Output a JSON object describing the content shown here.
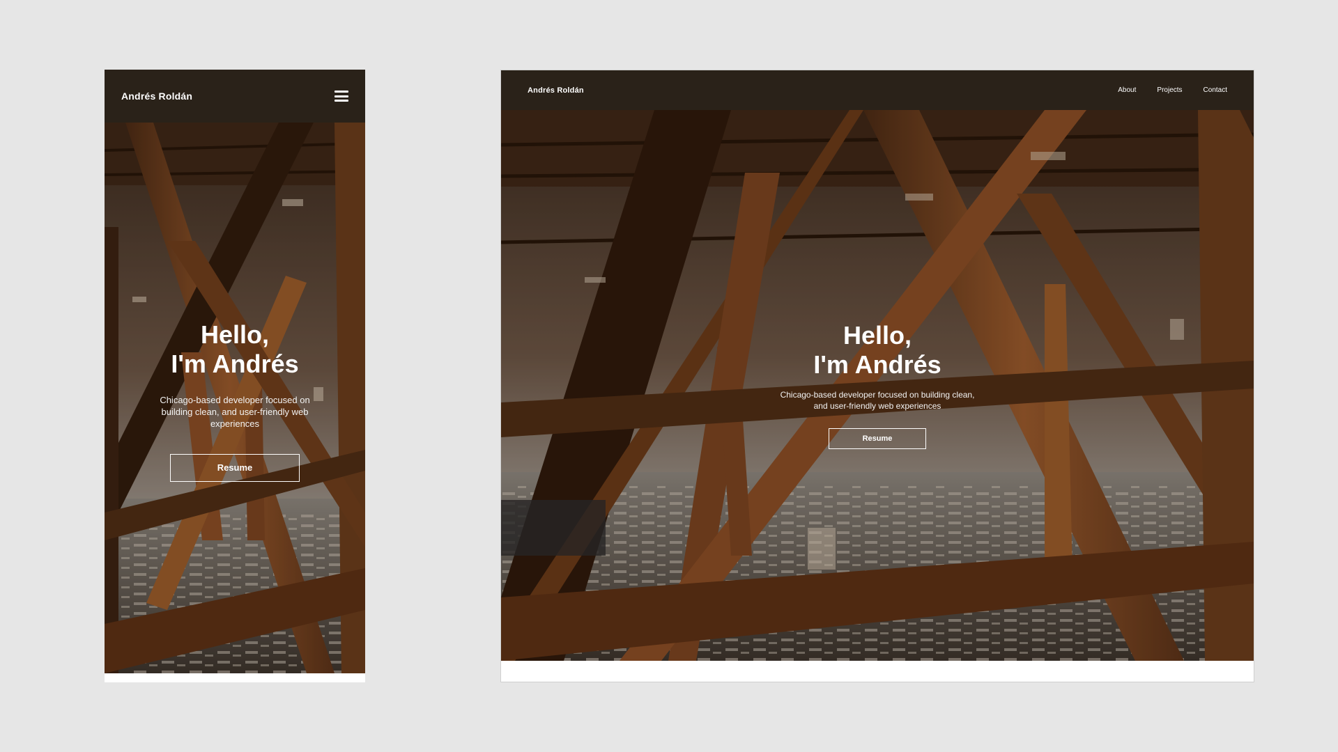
{
  "site": {
    "brand": "Andrés Roldán",
    "nav": [
      {
        "label": "About"
      },
      {
        "label": "Projects"
      },
      {
        "label": "Contact"
      }
    ],
    "hero": {
      "headline_line1": "Hello,",
      "headline_line2": "I'm Andrés",
      "tagline": "Chicago-based developer focused on building clean, and user-friendly web experiences",
      "cta_label": "Resume"
    }
  },
  "icons": {
    "menu": "hamburger-menu-icon"
  },
  "colors": {
    "page_background": "#e6e6e6",
    "navbar": "#2a2219",
    "text": "#ffffff",
    "steel": "#8a4e25"
  }
}
